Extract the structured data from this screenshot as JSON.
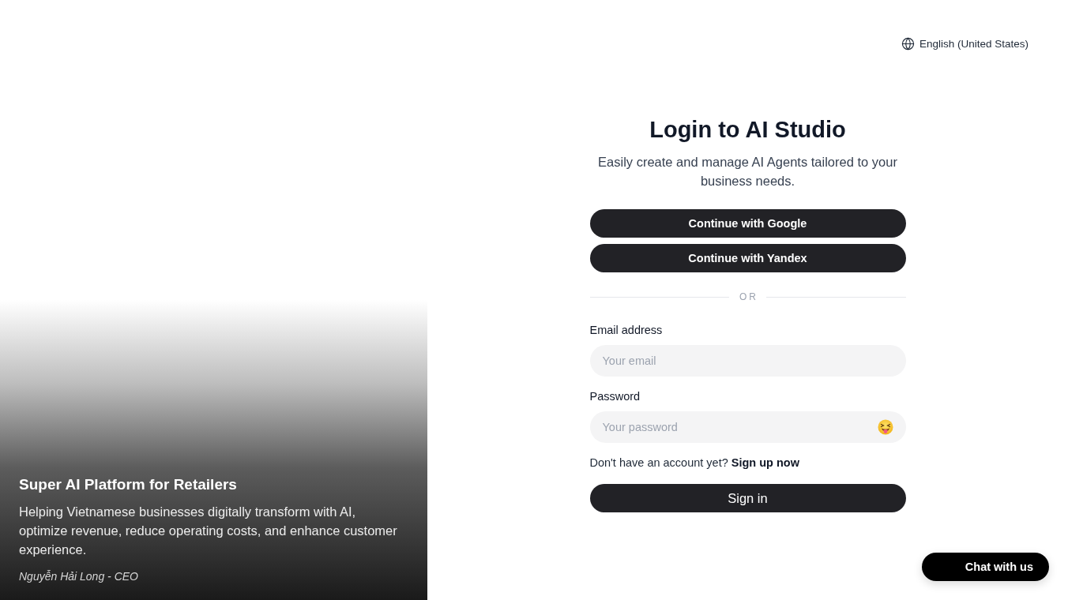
{
  "language_selector": {
    "label": "English (United States)"
  },
  "hero": {
    "title": "Super AI Platform for Retailers",
    "description": "Helping Vietnamese businesses digitally transform with AI, optimize revenue, reduce operating costs, and enhance customer experience.",
    "attribution": "Nguyễn Hải Long - CEO"
  },
  "login": {
    "title": "Login to AI Studio",
    "subtitle": "Easily create and manage AI Agents tailored to your business needs.",
    "social_buttons": [
      {
        "label": "Continue with Google"
      },
      {
        "label": "Continue with Yandex"
      }
    ],
    "divider": "OR",
    "fields": [
      {
        "kind": "email",
        "label": "Email address",
        "placeholder": "Your email"
      },
      {
        "kind": "password",
        "label": "Password",
        "placeholder": "Your password"
      }
    ],
    "signup_prompt": {
      "text": "Don't have an account yet?",
      "link": "Sign up now"
    },
    "submit": "Sign in"
  },
  "chat_button": {
    "label": "Chat with us"
  }
}
